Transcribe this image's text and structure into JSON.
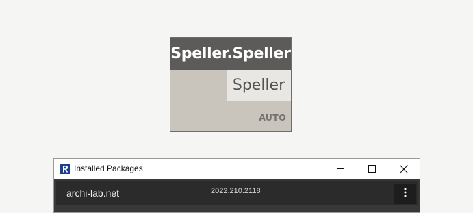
{
  "node": {
    "title": "Speller.Speller",
    "output_port": "Speller",
    "lacing": "AUTO"
  },
  "window": {
    "title": "Installed Packages",
    "app_icon": "revit-logo-icon",
    "controls": {
      "minimize_icon": "minimize-icon",
      "maximize_icon": "maximize-icon",
      "close_icon": "close-icon"
    },
    "packages": [
      {
        "name": "archi-lab.net",
        "version": "2022.210.2118",
        "menu_icon": "more-vertical-icon"
      }
    ]
  },
  "colors": {
    "canvas_background": "#f5f5f4",
    "node_header": "#5d5b59",
    "node_body": "#c9c5bd",
    "node_output_port": "#e9e7e3",
    "package_panel": "#383838",
    "package_row": "#2b2b2b",
    "revit_blue": "#1a3f8f"
  }
}
